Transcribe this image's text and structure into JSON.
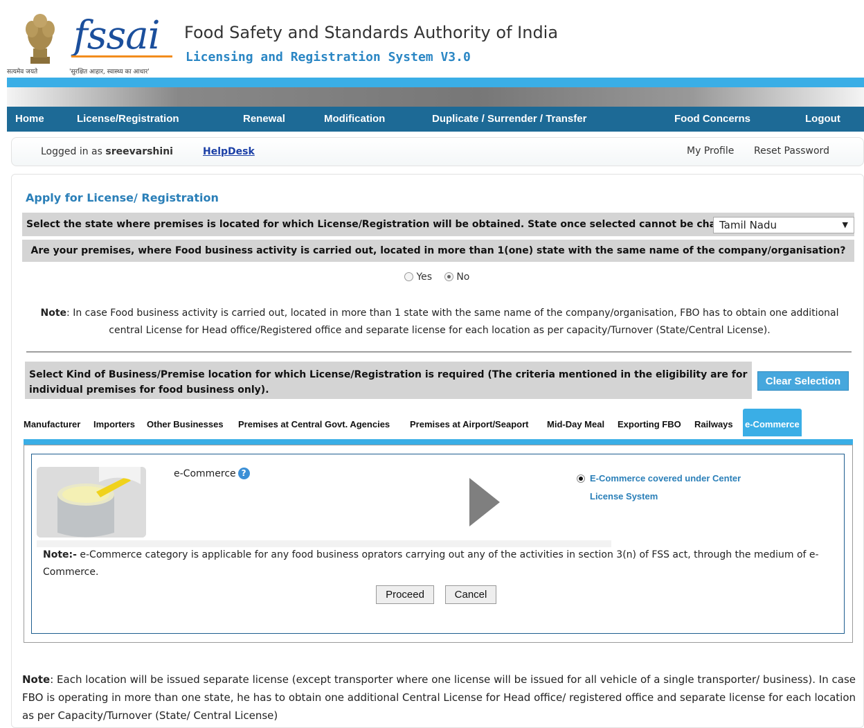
{
  "header": {
    "emblem_motto": "सत्यमेव जयते",
    "logo_text": "fssai",
    "logo_tagline": "'सुरक्षित आहार, स्वास्थ्य का आधार'",
    "org_name": "Food Safety and Standards Authority of India",
    "system_name": "Licensing and Registration System V3.0"
  },
  "nav": {
    "items": [
      {
        "label": "Home"
      },
      {
        "label": "License/Registration"
      },
      {
        "label": "Renewal"
      },
      {
        "label": "Modification"
      },
      {
        "label": "Duplicate / Surrender / Transfer"
      },
      {
        "label": "Food Concerns"
      },
      {
        "label": "Logout"
      }
    ]
  },
  "user_bar": {
    "logged_in_prefix": "Logged in as",
    "username": "sreevarshini",
    "helpdesk": "HelpDesk",
    "my_profile": "My Profile",
    "reset_password": "Reset Password"
  },
  "main": {
    "title": "Apply for License/ Registration",
    "state_prompt": "Select the state where premises is located for which License/Registration will be obtained. State once selected cannot be changed.",
    "state_selected": "Tamil Nadu",
    "multi_state_question": "Are your premises, where Food business activity is carried out, located in more than 1(one) state with the same name of the company/organisation?",
    "radio_yes": "Yes",
    "radio_no": "No",
    "multi_state_answer": "No",
    "note1_label": "Note",
    "note1_text": ": In case Food business activity is carried out, located in more than 1 state with the same name of the company/organisation, FBO has to obtain one additional central License for Head office/Registered office and separate license for each location as per capacity/Turnover (State/Central License).",
    "kind_prompt": "Select Kind of Business/Premise location for which License/Registration is required (The criteria mentioned in the eligibility are for individual premises for food business only).",
    "clear_selection": "Clear Selection"
  },
  "tabs": [
    {
      "label": "Manufacturer",
      "active": false
    },
    {
      "label": "Importers",
      "active": false
    },
    {
      "label": "Other Businesses",
      "active": false
    },
    {
      "label": "Premises at Central Govt. Agencies",
      "active": false
    },
    {
      "label": "Premises at Airport/Seaport",
      "active": false
    },
    {
      "label": "Mid-Day Meal",
      "active": false
    },
    {
      "label": "Exporting FBO",
      "active": false
    },
    {
      "label": "Railways",
      "active": false
    },
    {
      "label": "e-Commerce",
      "active": true
    }
  ],
  "ecommerce": {
    "label": "e-Commerce",
    "help_icon": "question-circle-icon",
    "option_text": "E-Commerce covered under Center License System",
    "option_selected": true,
    "note_label": "Note:-",
    "note_text": " e-Commerce category is applicable for any food business oprators carrying out any of the activities in section 3(n) of FSS act, through the medium of e-Commerce.",
    "proceed": "Proceed",
    "cancel": "Cancel"
  },
  "footer_note": {
    "label": "Note",
    "text": ": Each location will be issued separate license (except transporter where one license will be issued for all vehicle of a single transporter/ business). In case FBO is operating in more than one state, he has to obtain one additional Central License for Head office/ registered office and separate license for each location as per Capacity/Turnover (State/ Central License)"
  },
  "colors": {
    "nav_bg": "#1d6a96",
    "accent_blue": "#3aaee6",
    "title_blue": "#2a7fb8",
    "logo_orange": "#f28c1c"
  }
}
